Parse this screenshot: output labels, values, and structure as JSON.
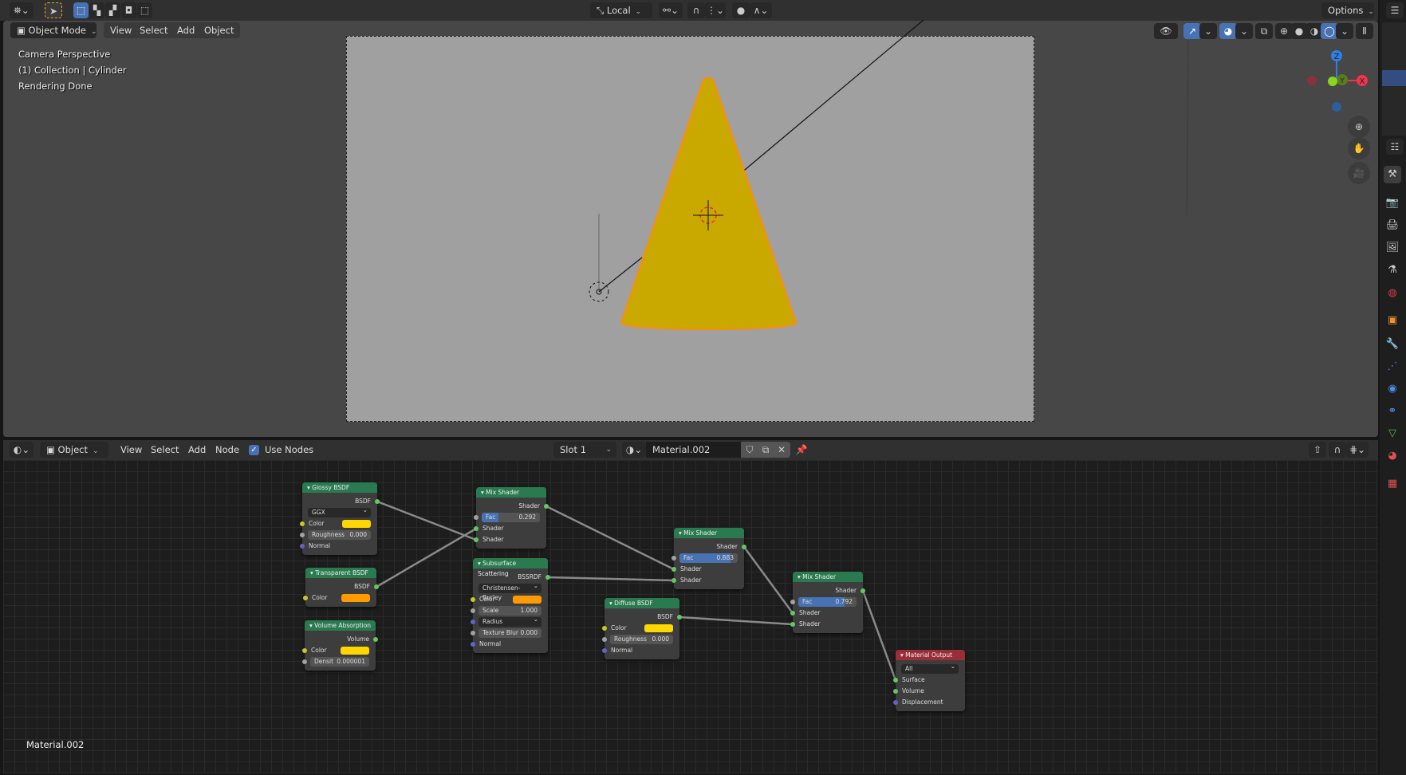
{
  "topbar": {
    "transform_orientation": "Local",
    "options_label": "Options"
  },
  "viewport": {
    "mode": "Object Mode",
    "menus": [
      "View",
      "Select",
      "Add",
      "Object"
    ],
    "overlay": [
      "Camera Perspective",
      "(1) Collection | Cylinder",
      "Rendering Done"
    ],
    "gizmo": {
      "x": "X",
      "y": "Y",
      "z": "Z"
    }
  },
  "node_editor": {
    "editor_type": "Object",
    "menus": [
      "View",
      "Select",
      "Add",
      "Node"
    ],
    "use_nodes_label": "Use Nodes",
    "use_nodes": true,
    "slot": "Slot 1",
    "material": "Material.002",
    "footer_label": "Material.002",
    "nodes": [
      {
        "id": "glossy",
        "title": "Glossy BSDF",
        "color": "#2a7a4f",
        "rows": [
          {
            "t": "out",
            "label": "BSDF"
          },
          {
            "t": "dd",
            "label": "GGX"
          },
          {
            "t": "color",
            "label": "Color",
            "value": "#ffd700"
          },
          {
            "t": "field",
            "label": "Roughness",
            "value": "0.000",
            "fill": 0
          },
          {
            "t": "in",
            "label": "Normal",
            "sock": "#6363c7"
          }
        ]
      },
      {
        "id": "transparent",
        "title": "Transparent BSDF",
        "color": "#2a7a4f",
        "rows": [
          {
            "t": "out",
            "label": "BSDF"
          },
          {
            "t": "color",
            "label": "Color",
            "value": "#ff9a00"
          }
        ]
      },
      {
        "id": "volume",
        "title": "Volume Absorption",
        "color": "#2a7a4f",
        "rows": [
          {
            "t": "out",
            "label": "Volume"
          },
          {
            "t": "color",
            "label": "Color",
            "value": "#ffd700"
          },
          {
            "t": "field",
            "label": "Densit",
            "value": "0.000001",
            "fill": 0
          }
        ]
      },
      {
        "id": "mix1",
        "title": "Mix Shader",
        "color": "#2a7a4f",
        "rows": [
          {
            "t": "out",
            "label": "Shader"
          },
          {
            "t": "field",
            "label": "Fac",
            "value": "0.292",
            "fill": 0.292
          },
          {
            "t": "in",
            "label": "Shader"
          },
          {
            "t": "in",
            "label": "Shader"
          }
        ]
      },
      {
        "id": "sss",
        "title": "Subsurface Scattering",
        "color": "#2a7a4f",
        "rows": [
          {
            "t": "out",
            "label": "BSSRDF"
          },
          {
            "t": "dd",
            "label": "Christensen-Burley"
          },
          {
            "t": "color",
            "label": "Color",
            "value": "#ff9a00"
          },
          {
            "t": "field",
            "label": "Scale",
            "value": "1.000",
            "fill": 0
          },
          {
            "t": "ddin",
            "label": "Radius"
          },
          {
            "t": "field",
            "label": "Texture Blur",
            "value": "0.000",
            "fill": 0
          },
          {
            "t": "in",
            "label": "Normal",
            "sock": "#6363c7"
          }
        ]
      },
      {
        "id": "mix2",
        "title": "Mix Shader",
        "color": "#2a7a4f",
        "rows": [
          {
            "t": "out",
            "label": "Shader"
          },
          {
            "t": "field",
            "label": "Fac",
            "value": "0.883",
            "fill": 0.883
          },
          {
            "t": "in",
            "label": "Shader"
          },
          {
            "t": "in",
            "label": "Shader"
          }
        ]
      },
      {
        "id": "diffuse",
        "title": "Diffuse BSDF",
        "color": "#2a7a4f",
        "rows": [
          {
            "t": "out",
            "label": "BSDF"
          },
          {
            "t": "color",
            "label": "Color",
            "value": "#ffd700"
          },
          {
            "t": "field",
            "label": "Roughness",
            "value": "0.000",
            "fill": 0
          },
          {
            "t": "in",
            "label": "Normal",
            "sock": "#6363c7"
          }
        ]
      },
      {
        "id": "mix3",
        "title": "Mix Shader",
        "color": "#2a7a4f",
        "rows": [
          {
            "t": "out",
            "label": "Shader"
          },
          {
            "t": "field",
            "label": "Fac",
            "value": "0.792",
            "fill": 0.792
          },
          {
            "t": "in",
            "label": "Shader"
          },
          {
            "t": "in",
            "label": "Shader"
          }
        ]
      },
      {
        "id": "output",
        "title": "Material Output",
        "color": "#9a2d38",
        "rows": [
          {
            "t": "dd",
            "label": "All"
          },
          {
            "t": "in",
            "label": "Surface"
          },
          {
            "t": "in",
            "label": "Volume"
          },
          {
            "t": "in",
            "label": "Displacement",
            "sock": "#6363c7"
          }
        ]
      }
    ],
    "links": [
      [
        "glossy",
        0,
        "mix1",
        3
      ],
      [
        "transparent",
        0,
        "mix1",
        2
      ],
      [
        "mix1",
        0,
        "mix2",
        2
      ],
      [
        "sss",
        0,
        "mix2",
        3
      ],
      [
        "mix2",
        0,
        "mix3",
        2
      ],
      [
        "diffuse",
        0,
        "mix3",
        3
      ],
      [
        "mix3",
        0,
        "output",
        1
      ]
    ]
  },
  "colors": {
    "accent": "#4772b3",
    "shader_socket": "#63c763",
    "color_socket": "#c7c729",
    "float_socket": "#a1a1a1",
    "vector_socket": "#6363c7",
    "cone": "#c9a800",
    "selection": "#ff8c00"
  }
}
